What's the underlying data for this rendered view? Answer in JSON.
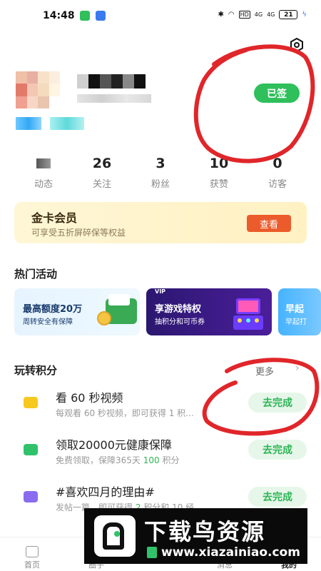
{
  "status_bar": {
    "time": "14:48",
    "battery": "21",
    "network_labels": [
      "HD",
      "4G",
      "4G"
    ]
  },
  "settings_icon": "settings-hexagon-icon",
  "profile": {
    "checkin_label": "已签"
  },
  "stats": [
    {
      "value": "",
      "label": "动态"
    },
    {
      "value": "26",
      "label": "关注"
    },
    {
      "value": "3",
      "label": "粉丝"
    },
    {
      "value": "10",
      "label": "获赞"
    },
    {
      "value": "0",
      "label": "访客"
    }
  ],
  "gold_card": {
    "title": "金卡会员",
    "subtitle": "可享受五折屏碎保等权益",
    "button": "查看"
  },
  "hot_activities": {
    "title": "热门活动",
    "banners": [
      {
        "title": "最高额度20万",
        "subtitle": "周转安全有保障"
      },
      {
        "top": "VIP",
        "title": "享游戏特权",
        "subtitle": "抽积分和可币券"
      },
      {
        "title": "早起",
        "subtitle": "早起打"
      }
    ]
  },
  "points": {
    "title": "玩转积分",
    "more": "更多",
    "tasks": [
      {
        "title": "看 60 秒视频",
        "desc_prefix": "每观看 60 秒视频，即可获得 1 ",
        "desc_points": "",
        "desc_suffix": "积...",
        "button": "去完成",
        "icon_color": "#f7c81e"
      },
      {
        "title": "领取20000元健康保障",
        "desc_prefix": "免费领取，保障365天 ",
        "desc_points": "100",
        "desc_suffix": " 积分",
        "button": "去完成",
        "icon_color": "#2fc26b"
      },
      {
        "title": "#喜欢四月的理由#",
        "desc_prefix": "发帖一篇，即可获得 ",
        "desc_points": "2",
        "desc_suffix": " 积分和 10 经...",
        "button": "去完成",
        "icon_color": "#8a6cf0"
      }
    ]
  },
  "bottom_nav": [
    {
      "label": "首页"
    },
    {
      "label": "圈子"
    },
    {
      "label": ""
    },
    {
      "label": "消息"
    },
    {
      "label": "我的"
    }
  ],
  "watermark": {
    "title": "下载鸟资源",
    "url": "www.xiazainiao.com"
  },
  "colors": {
    "accent_green": "#2fbf5b",
    "gold_button": "#ec5b2b",
    "annotation_red": "#e0262a"
  }
}
